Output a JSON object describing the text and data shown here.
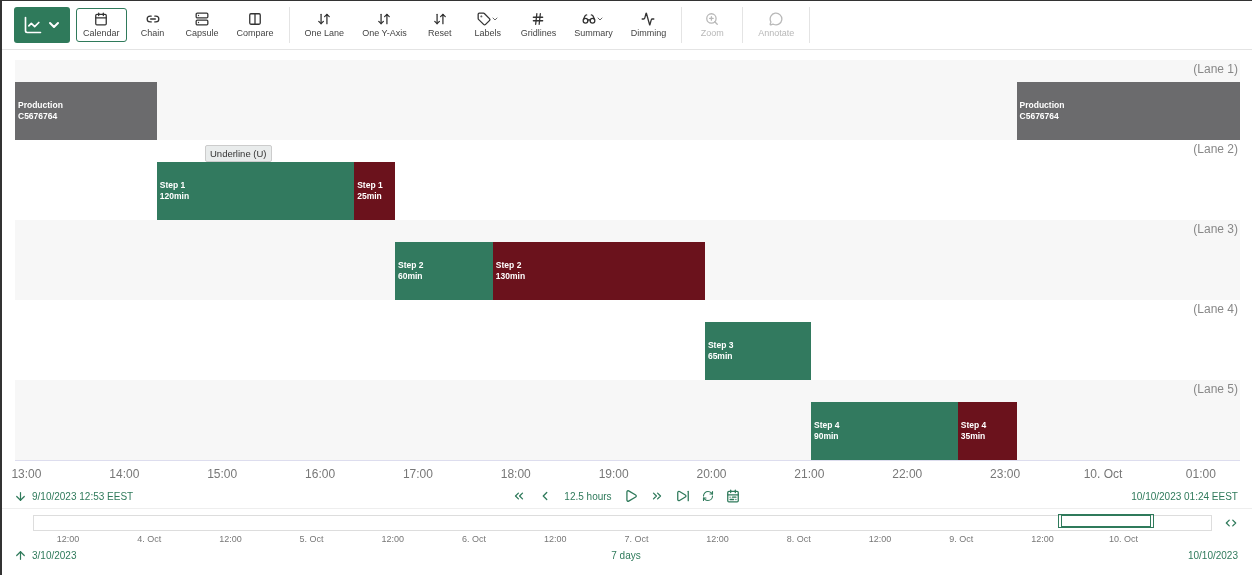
{
  "toolbar": {
    "view_button": {
      "selected": true
    },
    "tools": [
      {
        "label": "Calendar",
        "selected": true,
        "disabled": false,
        "dropdown": false
      },
      {
        "label": "Chain",
        "selected": false,
        "disabled": false,
        "dropdown": false
      },
      {
        "label": "Capsule",
        "selected": false,
        "disabled": false,
        "dropdown": false
      },
      {
        "label": "Compare",
        "selected": false,
        "disabled": false,
        "dropdown": false
      },
      {
        "label": "One Lane",
        "selected": false,
        "disabled": false,
        "dropdown": false
      },
      {
        "label": "One Y-Axis",
        "selected": false,
        "disabled": false,
        "dropdown": false
      },
      {
        "label": "Reset",
        "selected": false,
        "disabled": false,
        "dropdown": false
      },
      {
        "label": "Labels",
        "selected": false,
        "disabled": false,
        "dropdown": true
      },
      {
        "label": "Gridlines",
        "selected": false,
        "disabled": false,
        "dropdown": false
      },
      {
        "label": "Summary",
        "selected": false,
        "disabled": false,
        "dropdown": true
      },
      {
        "label": "Dimming",
        "selected": false,
        "disabled": false,
        "dropdown": false
      },
      {
        "label": "Zoom",
        "selected": false,
        "disabled": true,
        "dropdown": false
      },
      {
        "label": "Annotate",
        "selected": false,
        "disabled": true,
        "dropdown": false
      }
    ]
  },
  "timeline": {
    "tooltip": "Underline (U)",
    "lanes": [
      {
        "label": "(Lane 1)",
        "capsules": [
          {
            "title": "Production",
            "subtitle": "C5676764",
            "color": "#6b6b6d"
          },
          {
            "title": "Production",
            "subtitle": "C5676764",
            "color": "#6b6b6d"
          }
        ]
      },
      {
        "label": "(Lane 2)",
        "capsules": [
          {
            "title": "Step 1",
            "subtitle": "120min",
            "color": "#327a5f"
          },
          {
            "title": "Step 1",
            "subtitle": "25min",
            "color": "#6b121c"
          }
        ]
      },
      {
        "label": "(Lane 3)",
        "capsules": [
          {
            "title": "Step 2",
            "subtitle": "60min",
            "color": "#327a5f"
          },
          {
            "title": "Step 2",
            "subtitle": "130min",
            "color": "#6b121c"
          }
        ]
      },
      {
        "label": "(Lane 4)",
        "capsules": [
          {
            "title": "Step 3",
            "subtitle": "65min",
            "color": "#327a5f"
          }
        ]
      },
      {
        "label": "(Lane 5)",
        "capsules": [
          {
            "title": "Step 4",
            "subtitle": "90min",
            "color": "#327a5f"
          },
          {
            "title": "Step 4",
            "subtitle": "35min",
            "color": "#6b121c"
          }
        ]
      }
    ],
    "axis_ticks": [
      "13:00",
      "14:00",
      "15:00",
      "16:00",
      "17:00",
      "18:00",
      "19:00",
      "20:00",
      "21:00",
      "22:00",
      "23:00",
      "10. Oct",
      "01:00"
    ]
  },
  "display_range": {
    "start": "9/10/2023 12:53  EEST",
    "duration": "12.5 hours",
    "end": "10/10/2023 01:24  EEST"
  },
  "navigator": {
    "ticks": [
      "12:00",
      "4. Oct",
      "12:00",
      "5. Oct",
      "12:00",
      "6. Oct",
      "12:00",
      "7. Oct",
      "12:00",
      "8. Oct",
      "12:00",
      "9. Oct",
      "12:00",
      "10. Oct"
    ],
    "handles": [
      {
        "level": 0.87
      },
      {
        "level": 0.952
      }
    ],
    "start": "3/10/2023",
    "duration": "7 days",
    "end": "10/10/2023"
  }
}
